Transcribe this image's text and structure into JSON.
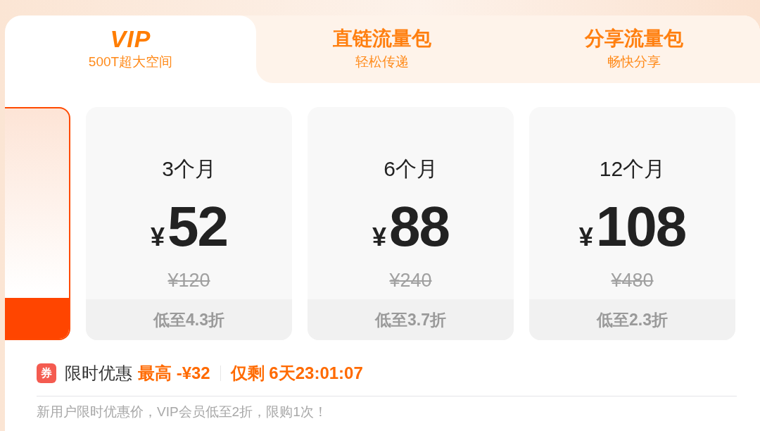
{
  "tabs": [
    {
      "kind": "logo",
      "title": "VIP",
      "subtitle": "500T超大空间",
      "selected": true
    },
    {
      "kind": "text",
      "title": "直链流量包",
      "subtitle": "轻松传递",
      "selected": false
    },
    {
      "kind": "text",
      "title": "分享流量包",
      "subtitle": "畅快分享",
      "selected": false
    }
  ],
  "plans": [
    {
      "selected": true
    },
    {
      "period": "3个月",
      "currency": "¥",
      "price": "52",
      "original_price": "¥120",
      "discount": "低至4.3折",
      "selected": false
    },
    {
      "period": "6个月",
      "currency": "¥",
      "price": "88",
      "original_price": "¥240",
      "discount": "低至3.7折",
      "selected": false
    },
    {
      "period": "12个月",
      "currency": "¥",
      "price": "108",
      "original_price": "¥480",
      "discount": "低至2.3折",
      "selected": false
    }
  ],
  "promotion": {
    "badge": "券",
    "label": "限时优惠",
    "max_discount": "最高 -¥32",
    "countdown": "仅剩 6天23:01:07"
  },
  "note": "新用户限时优惠价，VIP会员低至2折，限购1次！"
}
